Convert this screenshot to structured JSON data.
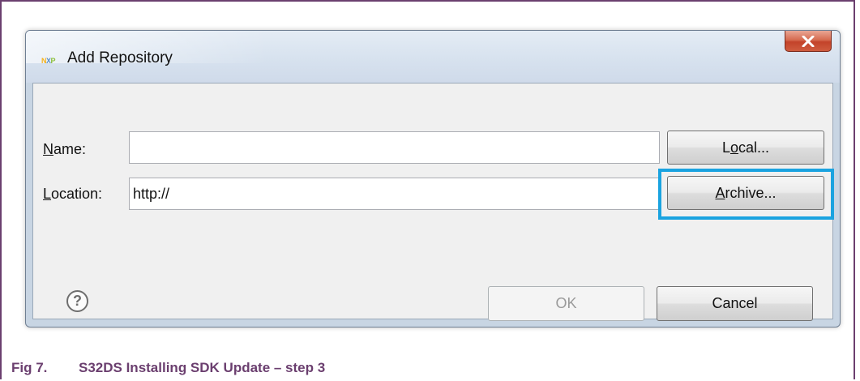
{
  "window": {
    "title": "Add Repository",
    "logo_text": "NXP"
  },
  "form": {
    "name_label_accel": "N",
    "name_label_rest": "ame:",
    "name_value": "",
    "location_label_accel": "L",
    "location_label_rest": "ocation:",
    "location_value": "http://"
  },
  "buttons": {
    "local_pre": "L",
    "local_accel": "o",
    "local_post": "cal...",
    "archive_accel": "A",
    "archive_post": "rchive...",
    "ok": "OK",
    "cancel": "Cancel"
  },
  "help": {
    "glyph": "?"
  },
  "caption": {
    "number": "Fig 7.",
    "text": "S32DS Installing SDK Update – step 3",
    "color": "#6b3f6f"
  },
  "colors": {
    "highlight": "#1aa3e0",
    "close_button": "#c3432a"
  }
}
